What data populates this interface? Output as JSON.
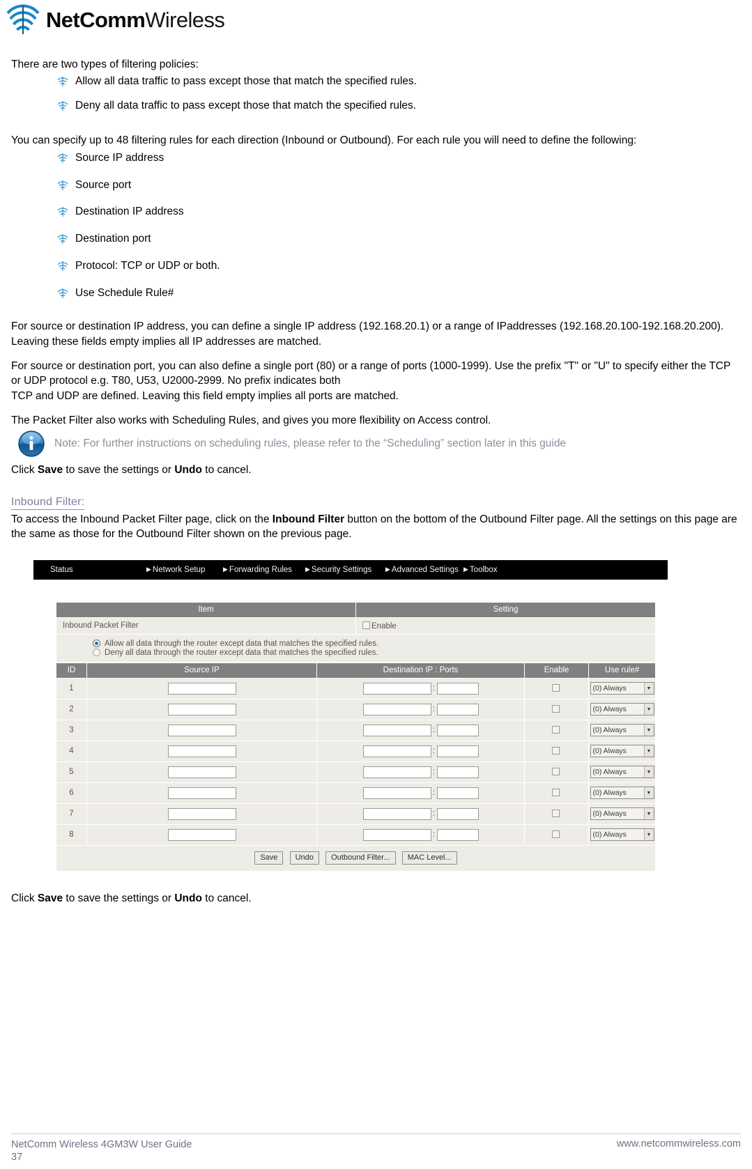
{
  "brand": {
    "logo_bold": "NetComm",
    "logo_light": "Wireless",
    "logo_icon": "wifi-arc-icon",
    "accent_blue": "#1b86c8"
  },
  "doc": {
    "intro": "There are two types of filtering policies:",
    "policy_bullets": [
      "Allow all data traffic to pass except those that match the specified rules.",
      "Deny all data traffic to pass except those that match the specified rules."
    ],
    "rules_intro": "You can specify up to 48 filtering rules for each direction (Inbound or Outbound). For each rule you will need to define the following:",
    "rule_bullets": [
      "Source IP address",
      "Source port",
      "Destination IP address",
      "Destination port",
      "Protocol: TCP or UDP or both.",
      "Use Schedule Rule#"
    ],
    "para_ip": "For source or destination IP address, you can define a single IP address (192.168.20.1) or a range of IPaddresses (192.168.20.100-192.168.20.200). Leaving these fields empty implies all IP addresses are matched.",
    "para_port_line1": "For source or destination port, you can also define a single port (80) or a range of ports (1000-1999). Use the prefix \"T\" or \"U\" to specify either the TCP or UDP protocol e.g. T80, U53, U2000-2999. No prefix indicates both",
    "para_port_line2": "TCP and UDP are defined. Leaving this field empty implies all ports are matched.",
    "para_schedule": "The Packet Filter also works with Scheduling Rules, and gives you more flexibility on Access control.",
    "note_icon": "info-icon",
    "note_text": "Note: For further instructions on scheduling rules, please refer to the “Scheduling” section later in this guide",
    "click_save_prefix": "Click ",
    "click_save_bold": "Save",
    "click_save_mid": " to save the settings or ",
    "click_undo_bold": "Undo",
    "click_save_suffix": " to cancel.",
    "subhead": "Inbound Filter:",
    "inbound_para_a": "To access the Inbound Packet Filter page, click on the ",
    "inbound_para_bold": "Inbound Filter",
    "inbound_para_b": " button on the bottom of the Outbound Filter page. All the settings on this page are the same as those for the Outbound Filter shown on the previous page."
  },
  "router_ui": {
    "nav": [
      {
        "label": "Status",
        "caret": ""
      },
      {
        "label": "Network Setup",
        "caret": "▶"
      },
      {
        "label": "Forwarding Rules",
        "caret": "▶"
      },
      {
        "label": "Security Settings",
        "caret": "▶"
      },
      {
        "label": "Advanced Settings",
        "caret": "▶"
      },
      {
        "label": "Toolbox",
        "caret": "▶"
      }
    ],
    "top_table": {
      "headers": [
        "Item",
        "Setting"
      ],
      "row_label": "Inbound Packet Filter",
      "enable_label": "Enable",
      "enable_checked": false
    },
    "policy_radios": [
      {
        "label": "Allow all data through the router except data that matches the specified rules.",
        "selected": true
      },
      {
        "label": "Deny all data through the router except data that matches the specified rules.",
        "selected": false
      }
    ],
    "rules_table": {
      "headers": [
        "ID",
        "Source IP",
        "Destination IP : Ports",
        "Enable",
        "Use rule#"
      ],
      "rows": [
        {
          "id": "1",
          "source_ip": "",
          "dest_ip": "",
          "port": "",
          "enable": false,
          "rule": "(0) Always"
        },
        {
          "id": "2",
          "source_ip": "",
          "dest_ip": "",
          "port": "",
          "enable": false,
          "rule": "(0) Always"
        },
        {
          "id": "3",
          "source_ip": "",
          "dest_ip": "",
          "port": "",
          "enable": false,
          "rule": "(0) Always"
        },
        {
          "id": "4",
          "source_ip": "",
          "dest_ip": "",
          "port": "",
          "enable": false,
          "rule": "(0) Always"
        },
        {
          "id": "5",
          "source_ip": "",
          "dest_ip": "",
          "port": "",
          "enable": false,
          "rule": "(0) Always"
        },
        {
          "id": "6",
          "source_ip": "",
          "dest_ip": "",
          "port": "",
          "enable": false,
          "rule": "(0) Always"
        },
        {
          "id": "7",
          "source_ip": "",
          "dest_ip": "",
          "port": "",
          "enable": false,
          "rule": "(0) Always"
        },
        {
          "id": "8",
          "source_ip": "",
          "dest_ip": "",
          "port": "",
          "enable": false,
          "rule": "(0) Always"
        }
      ]
    },
    "buttons": [
      "Save",
      "Undo",
      "Outbound Filter...",
      "MAC Level..."
    ]
  },
  "footer": {
    "left_line1": "NetComm Wireless 4GM3W User Guide",
    "left_line2": "37",
    "right": "www.netcommwireless.com"
  }
}
